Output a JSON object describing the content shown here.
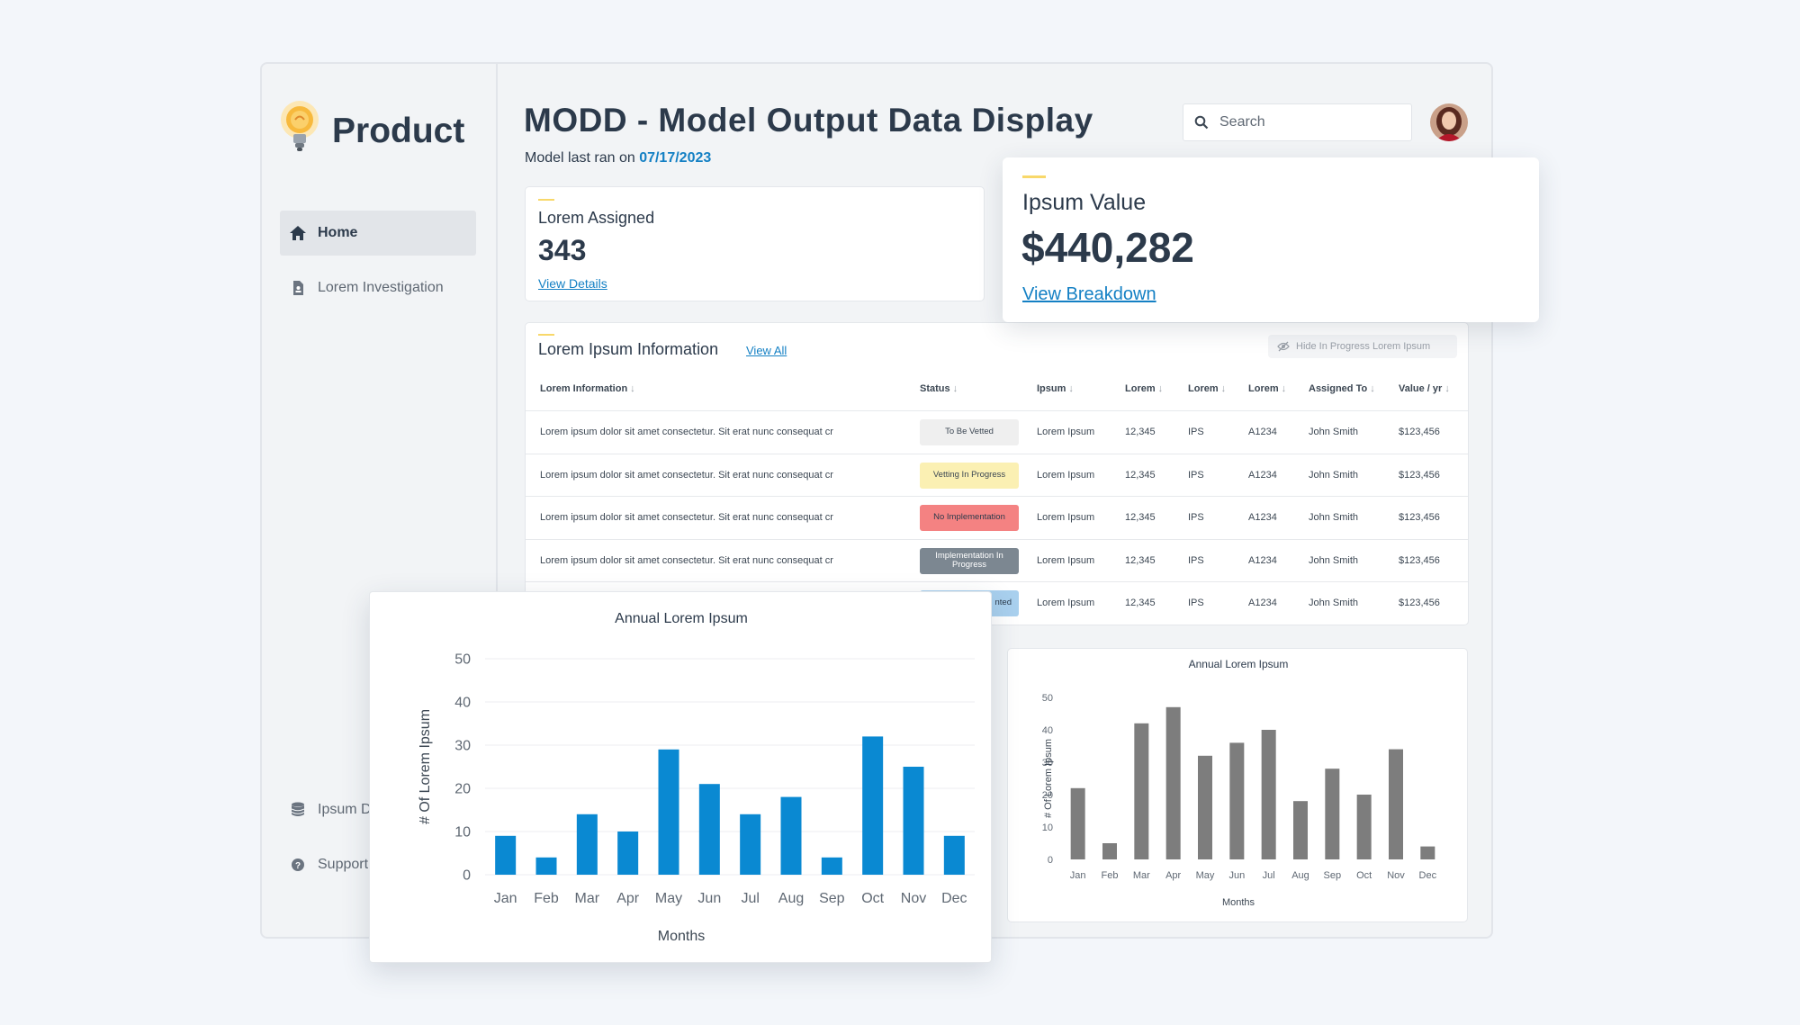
{
  "sidebar": {
    "logo_text": "Product",
    "items": [
      {
        "label": "Home",
        "icon": "home-icon"
      },
      {
        "label": "Lorem Investigation",
        "icon": "document-icon"
      },
      {
        "label": "Ipsum D",
        "icon": "database-icon"
      },
      {
        "label": "Support",
        "icon": "help-icon"
      }
    ]
  },
  "header": {
    "title": "MODD - Model Output Data Display",
    "subtitle_prefix": "Model last ran on",
    "last_run_date": "07/17/2023",
    "search_placeholder": "Search"
  },
  "cards": {
    "assigned": {
      "label": "Lorem Assigned",
      "value": "343",
      "link": "View Details"
    },
    "value": {
      "label": "Ipsum Value",
      "value": "$440,282",
      "link": "View Breakdown"
    }
  },
  "table": {
    "title": "Lorem Ipsum Information",
    "view_all": "View All",
    "hide_button": "Hide In Progress Lorem Ipsum",
    "columns": [
      "Lorem Information",
      "Status",
      "Ipsum",
      "Lorem",
      "Lorem",
      "Lorem",
      "Assigned To",
      "Value / yr"
    ],
    "sort_arrow": "↓",
    "rows": [
      {
        "info": "Lorem ipsum dolor sit amet consectetur. Sit erat nunc consequat cr",
        "status": "To Be Vetted",
        "ipsum": "Lorem Ipsum",
        "lorem1": "12,345",
        "lorem2": "IPS",
        "lorem3": "A1234",
        "assigned": "John Smith",
        "value": "$123,456"
      },
      {
        "info": "Lorem ipsum dolor sit amet consectetur. Sit erat nunc consequat cr",
        "status": "Vetting In Progress",
        "ipsum": "Lorem Ipsum",
        "lorem1": "12,345",
        "lorem2": "IPS",
        "lorem3": "A1234",
        "assigned": "John Smith",
        "value": "$123,456"
      },
      {
        "info": "Lorem ipsum dolor sit amet consectetur. Sit erat nunc consequat cr",
        "status": "No Implementation",
        "ipsum": "Lorem Ipsum",
        "lorem1": "12,345",
        "lorem2": "IPS",
        "lorem3": "A1234",
        "assigned": "John Smith",
        "value": "$123,456"
      },
      {
        "info": "Lorem ipsum dolor sit amet consectetur. Sit erat nunc consequat cr",
        "status": "Implementation In Progress",
        "ipsum": "Lorem Ipsum",
        "lorem1": "12,345",
        "lorem2": "IPS",
        "lorem3": "A1234",
        "assigned": "John Smith",
        "value": "$123,456"
      },
      {
        "info": "",
        "status": "nted",
        "ipsum": "Lorem Ipsum",
        "lorem1": "12,345",
        "lorem2": "IPS",
        "lorem3": "A1234",
        "assigned": "John Smith",
        "value": "$123,456"
      }
    ],
    "status_colors": {
      "To Be Vetted": {
        "bg": "#efefef",
        "fg": "#3c4753"
      },
      "Vetting In Progress": {
        "bg": "#fbf0b3",
        "fg": "#3c4753"
      },
      "No Implementation": {
        "bg": "#f48282",
        "fg": "#2c3a4b"
      },
      "Implementation In Progress": {
        "bg": "#7c8791",
        "fg": "#ffffff"
      },
      "nted": {
        "bg": "#a9d0ee",
        "fg": "#2c3a4b"
      }
    }
  },
  "colors": {
    "accent": "#1480c4",
    "bar_blue": "#0a89d2",
    "bar_gray": "#7d7d7d",
    "highlight": "#f8d86a"
  },
  "chart_data": [
    {
      "type": "bar",
      "title": "Annual Lorem Ipsum",
      "xlabel": "Months",
      "ylabel": "# Of Lorem Ipsum",
      "categories": [
        "Jan",
        "Feb",
        "Mar",
        "Apr",
        "May",
        "Jun",
        "Jul",
        "Aug",
        "Sep",
        "Oct",
        "Nov",
        "Dec"
      ],
      "values": [
        9,
        4,
        14,
        10,
        29,
        21,
        14,
        18,
        4,
        32,
        25,
        9
      ],
      "ylim": [
        0,
        50
      ],
      "yticks": [
        0,
        10,
        20,
        30,
        40,
        50
      ],
      "color": "#0a89d2",
      "grid": true
    },
    {
      "type": "bar",
      "title": "Annual Lorem Ipsum",
      "xlabel": "Months",
      "ylabel": "# Of Lorem Ipsum",
      "categories": [
        "Jan",
        "Feb",
        "Mar",
        "Apr",
        "May",
        "Jun",
        "Jul",
        "Aug",
        "Sep",
        "Oct",
        "Nov",
        "Dec"
      ],
      "values": [
        22,
        5,
        42,
        47,
        32,
        36,
        40,
        18,
        28,
        20,
        34,
        4
      ],
      "ylim": [
        0,
        50
      ],
      "yticks": [
        0,
        10,
        20,
        30,
        40,
        50
      ],
      "color": "#7d7d7d",
      "grid": false
    }
  ]
}
